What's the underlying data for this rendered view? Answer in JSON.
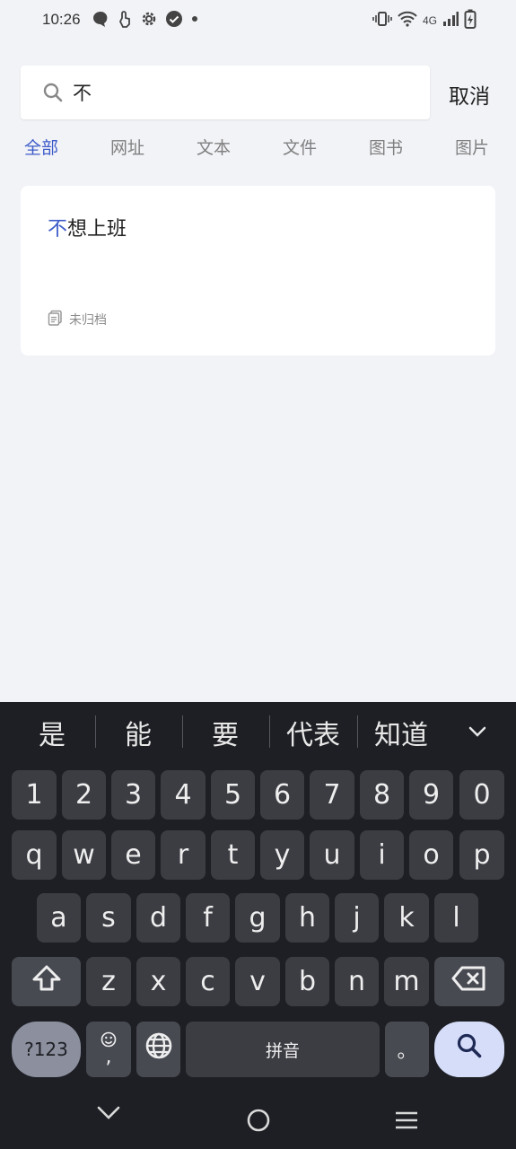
{
  "status_bar": {
    "time": "10:26",
    "left_icons": [
      "message-icon",
      "touch-icon",
      "settings-icon",
      "check-circle-icon",
      "dot-icon"
    ],
    "right_icons": [
      "vibrate-icon",
      "wifi-icon",
      "signal-icon",
      "battery-charging-icon"
    ],
    "network": "4G"
  },
  "search": {
    "query": "不",
    "cancel_label": "取消"
  },
  "tabs": [
    {
      "label": "全部",
      "active": true
    },
    {
      "label": "网址",
      "active": false
    },
    {
      "label": "文本",
      "active": false
    },
    {
      "label": "文件",
      "active": false
    },
    {
      "label": "图书",
      "active": false
    },
    {
      "label": "图片",
      "active": false
    }
  ],
  "results": [
    {
      "title_highlight": "不",
      "title_rest": "想上班",
      "folder": "未归档"
    }
  ],
  "keyboard": {
    "suggestions": [
      "是",
      "能",
      "要",
      "代表",
      "知道"
    ],
    "number_row": [
      "1",
      "2",
      "3",
      "4",
      "5",
      "6",
      "7",
      "8",
      "9",
      "0"
    ],
    "row1": [
      "q",
      "w",
      "e",
      "r",
      "t",
      "y",
      "u",
      "i",
      "o",
      "p"
    ],
    "row2": [
      "a",
      "s",
      "d",
      "f",
      "g",
      "h",
      "j",
      "k",
      "l"
    ],
    "row3": [
      "z",
      "x",
      "c",
      "v",
      "b",
      "n",
      "m"
    ],
    "symbols_label": "?123",
    "emoji_comma": ",",
    "space_label": "拼音",
    "period": "。"
  },
  "colors": {
    "accent": "#3d5bc9",
    "background": "#f2f3f7",
    "keyboard_bg": "#1e1f24",
    "key_bg": "#3c3d43"
  }
}
